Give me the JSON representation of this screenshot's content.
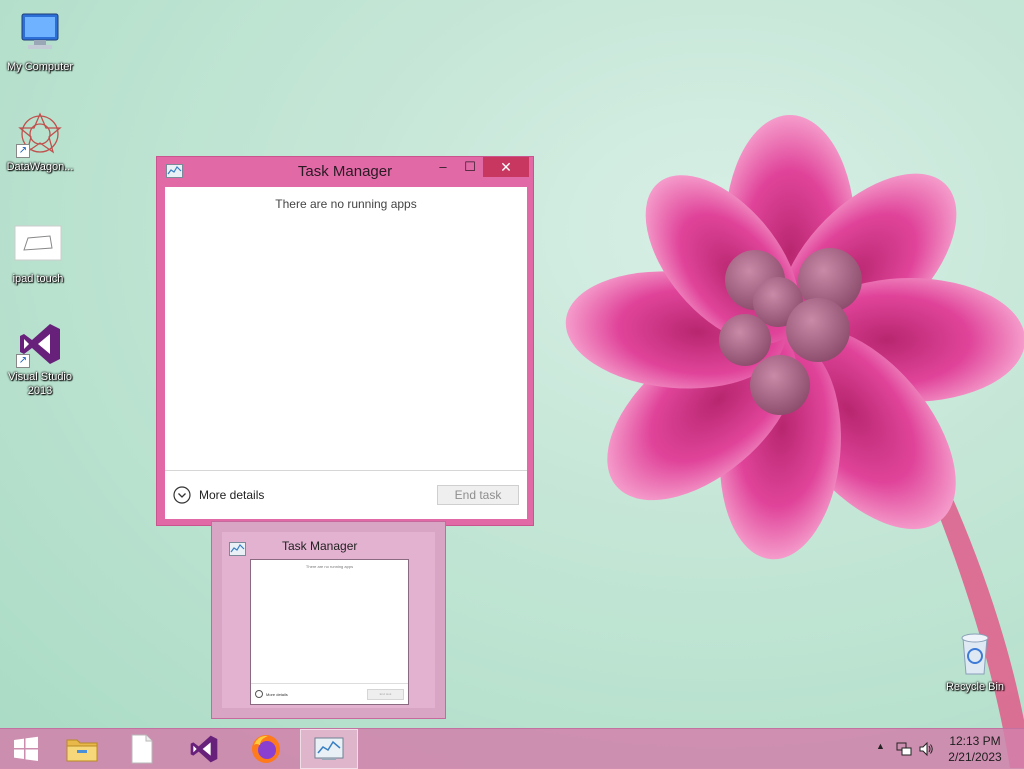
{
  "desktop": {
    "icons": [
      {
        "label": "My Computer"
      },
      {
        "label": "DataWagon..."
      },
      {
        "label": "ipad touch"
      },
      {
        "label": "Visual Studio\n2013"
      },
      {
        "label": "Recycle Bin"
      }
    ]
  },
  "window": {
    "title": "Task Manager",
    "minimize_glyph": "–",
    "maximize_glyph": "☐",
    "close_glyph": "✕",
    "empty_message": "There are no running apps",
    "more_details_label": "More details",
    "end_task_label": "End task"
  },
  "thumbnail": {
    "title": "Task Manager",
    "empty_message": "There are no running apps",
    "more_details_label": "More details",
    "end_task_label": "End task"
  },
  "taskbar": {
    "items": [
      {
        "name": "start-button",
        "icon": "windows-logo-icon"
      },
      {
        "name": "file-explorer",
        "icon": "folder-icon"
      },
      {
        "name": "blank-document",
        "icon": "document-icon"
      },
      {
        "name": "visual-studio",
        "icon": "visual-studio-icon"
      },
      {
        "name": "firefox",
        "icon": "firefox-icon"
      },
      {
        "name": "task-manager",
        "icon": "task-manager-icon",
        "active": true
      }
    ],
    "tray_chevron": "▲",
    "time": "12:13 PM",
    "date": "2/21/2023"
  },
  "colors": {
    "window_frame": "#e16aa6",
    "close_button": "#c7375f",
    "taskbar": "#d180aa"
  }
}
